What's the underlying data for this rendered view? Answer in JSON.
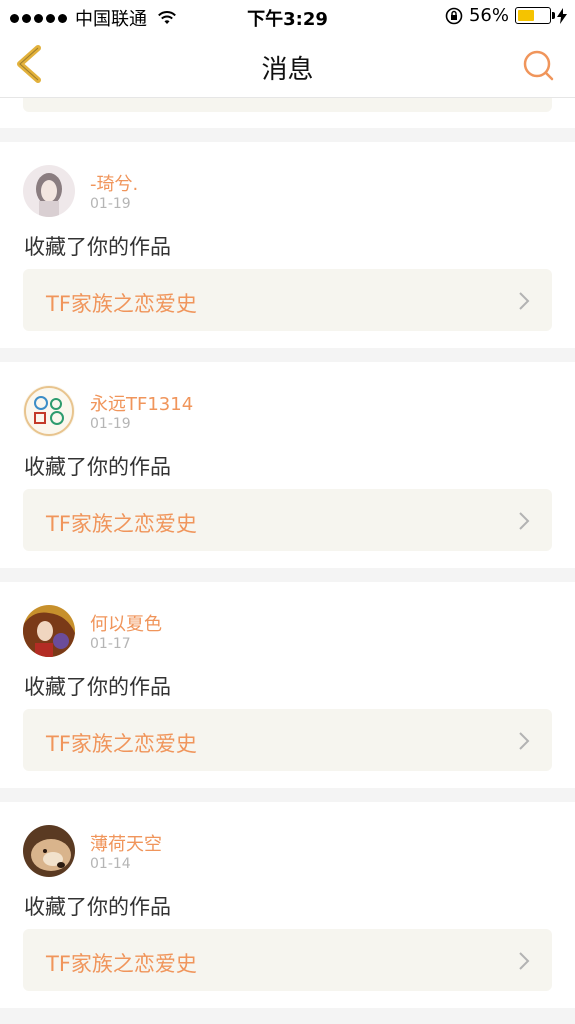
{
  "status_bar": {
    "carrier": "中国联通",
    "time": "下午3:29",
    "battery": "56%",
    "battery_level": 0.56
  },
  "nav": {
    "title": "消息"
  },
  "colors": {
    "accent": "#f0955b",
    "nav_back": "#e2b13c",
    "work_box_bg": "#f6f5ef"
  },
  "notifications": [
    {
      "username": "-琦兮.",
      "date": "01-19",
      "message": "收藏了你的作品",
      "work_title": "TF家族之恋爱史"
    },
    {
      "username": "永远TF1314",
      "date": "01-19",
      "message": "收藏了你的作品",
      "work_title": "TF家族之恋爱史"
    },
    {
      "username": "何以夏色",
      "date": "01-17",
      "message": "收藏了你的作品",
      "work_title": "TF家族之恋爱史"
    },
    {
      "username": "薄荷天空",
      "date": "01-14",
      "message": "收藏了你的作品",
      "work_title": "TF家族之恋爱史"
    }
  ]
}
